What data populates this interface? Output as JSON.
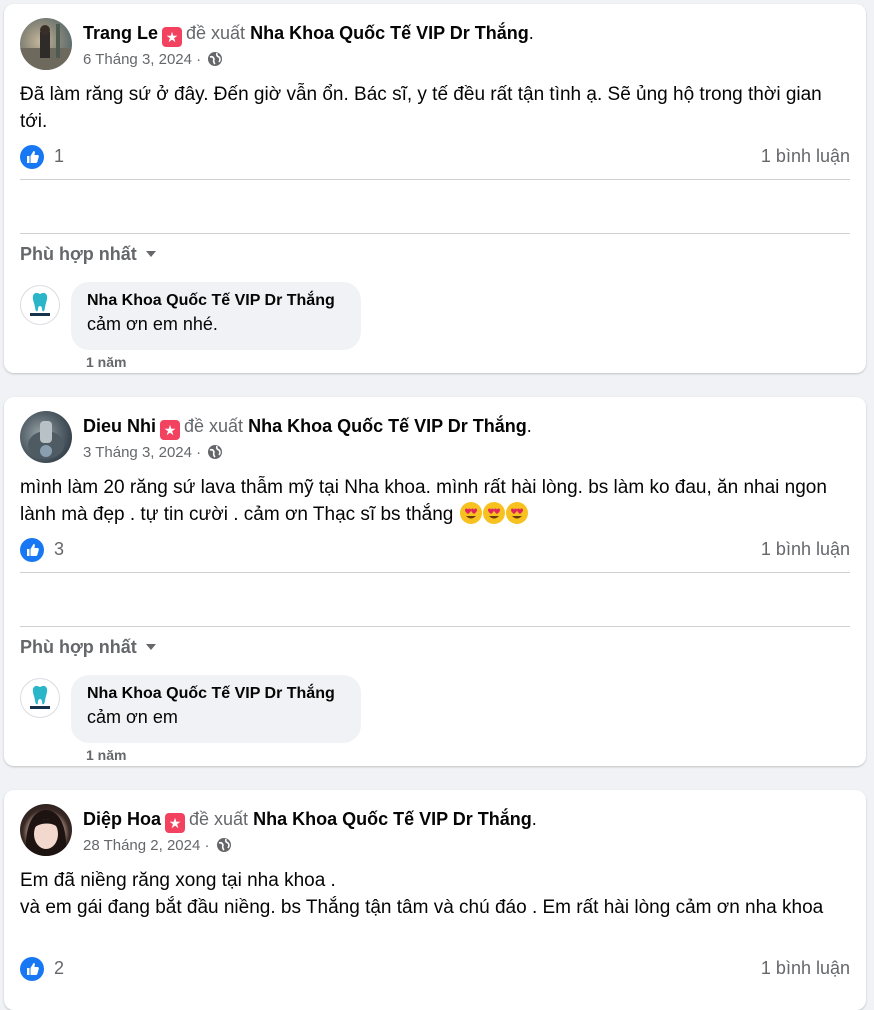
{
  "common": {
    "recommends_text": "đề xuất",
    "page_name": "Nha Khoa Quốc Tế VIP Dr Thắng",
    "period": ".",
    "badge_glyph": "★",
    "dot_sep": " · ",
    "sort_label": "Phù hợp nhất",
    "reply_time": "1 năm",
    "colors": {
      "like_blue": "#1877f2",
      "badge_pink": "#f3425f",
      "secondary_text": "#65676b",
      "bubble_bg": "#f0f2f5",
      "tooth_teal": "#2bb5c9"
    }
  },
  "posts": [
    {
      "author": "Trang Le",
      "date": "6 Tháng 3, 2024",
      "text": "Đã làm răng sứ ở đây. Đến giờ vẫn ổn. Bác sĩ, y tế đều rất tận tình ạ. Sẽ ủng hộ trong thời gian tới.",
      "likes": "1",
      "comments": "1 bình luận",
      "reply": {
        "name": "Nha Khoa Quốc Tế VIP Dr Thắng",
        "text": "cảm ơn em nhé."
      }
    },
    {
      "author": "Dieu Nhi",
      "date": "3 Tháng 3, 2024",
      "text": "mình làm 20 răng sứ  lava thẫm mỹ tại Nha khoa. mình rất hài lòng. bs làm ko đau, ăn nhai ngon lành mà đẹp . tự tin cười . cảm ơn Thạc sĩ bs thắng",
      "emojis": [
        "heart-eyes-emoji",
        "heart-eyes-emoji",
        "heart-eyes-emoji"
      ],
      "likes": "3",
      "comments": "1 bình luận",
      "reply": {
        "name": "Nha Khoa Quốc Tế VIP Dr Thắng",
        "text": "cảm ơn em"
      }
    },
    {
      "author": "Diệp Hoa",
      "date": "28 Tháng 2, 2024",
      "text": "Em đã niềng răng xong tại nha khoa .\nvà em gái đang bắt đầu niềng. bs Thắng tận tâm và chú đáo . Em rất hài lòng cảm ơn nha khoa",
      "likes": "2",
      "comments": "1 bình luận"
    }
  ]
}
